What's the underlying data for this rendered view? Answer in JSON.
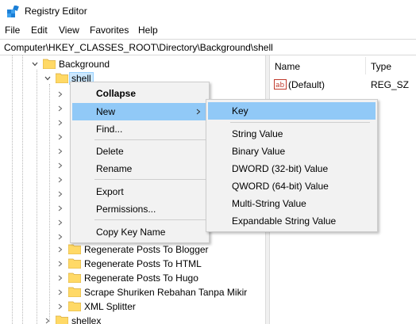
{
  "window": {
    "title": "Registry Editor"
  },
  "menubar": [
    "File",
    "Edit",
    "View",
    "Favorites",
    "Help"
  ],
  "address": "Computer\\HKEY_CLASSES_ROOT\\Directory\\Background\\shell",
  "tree": {
    "background": "Background",
    "shell": "shell",
    "visible_keys": [
      "Regenerate Posts To Blogger",
      "Regenerate Posts To HTML",
      "Regenerate Posts To Hugo",
      "Scrape Shuriken Rebahan Tanpa Mikir",
      "XML Splitter"
    ],
    "shellex": "shellex"
  },
  "list": {
    "columns": [
      "Name",
      "Type"
    ],
    "rows": [
      {
        "name": "(Default)",
        "type": "REG_SZ"
      }
    ]
  },
  "context_menu": {
    "items": [
      "Collapse",
      "New",
      "Find...",
      "Delete",
      "Rename",
      "Export",
      "Permissions...",
      "Copy Key Name"
    ]
  },
  "new_submenu": {
    "items": [
      "Key",
      "String Value",
      "Binary Value",
      "DWORD (32-bit) Value",
      "QWORD (64-bit) Value",
      "Multi-String Value",
      "Expandable String Value"
    ]
  },
  "colors": {
    "selection": "#cce8ff",
    "menu_highlight": "#91c9f7",
    "folder": "#ffd966"
  }
}
